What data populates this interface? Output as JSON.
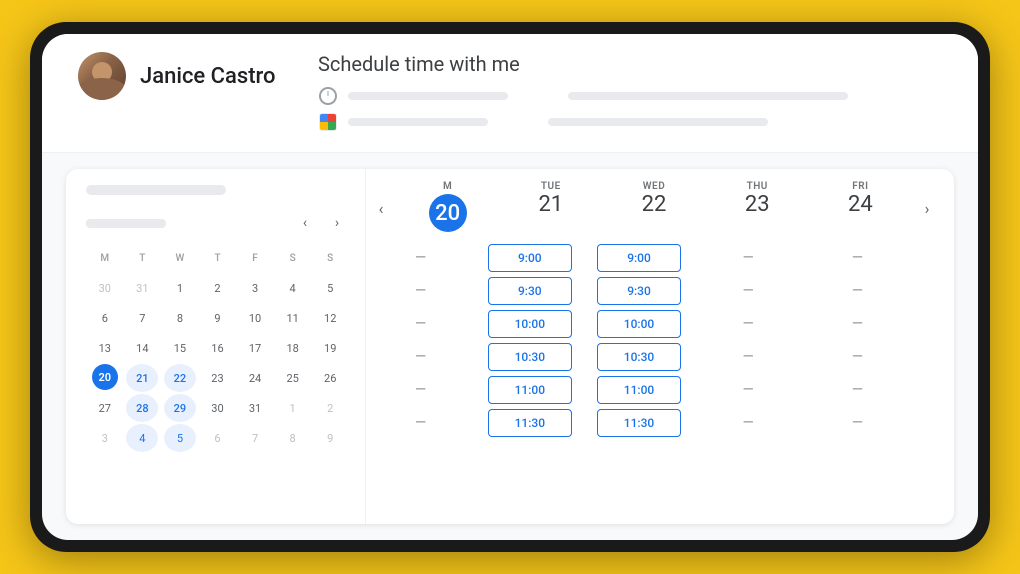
{
  "user": {
    "name": "Janice Castro"
  },
  "schedule": {
    "title": "Schedule time with me"
  },
  "calendar": {
    "top_bar": "",
    "month_label": "",
    "days_header": [
      "M",
      "T",
      "W",
      "T",
      "F",
      "S",
      "S"
    ],
    "weeks": [
      [
        {
          "n": 30,
          "other": true
        },
        {
          "n": 31,
          "other": true
        },
        {
          "n": 1
        },
        {
          "n": 2
        },
        {
          "n": 3
        },
        {
          "n": 4
        },
        {
          "n": 5
        }
      ],
      [
        {
          "n": 6
        },
        {
          "n": 7
        },
        {
          "n": 8
        },
        {
          "n": 9
        },
        {
          "n": 10
        },
        {
          "n": 11
        },
        {
          "n": 12
        }
      ],
      [
        {
          "n": 13
        },
        {
          "n": 14
        },
        {
          "n": 15
        },
        {
          "n": 16
        },
        {
          "n": 17
        },
        {
          "n": 18
        },
        {
          "n": 19
        }
      ],
      [
        {
          "n": 20,
          "today": true
        },
        {
          "n": 21,
          "selected": true
        },
        {
          "n": 22,
          "selected": true
        },
        {
          "n": 23
        },
        {
          "n": 24
        },
        {
          "n": 25
        },
        {
          "n": 26
        }
      ],
      [
        {
          "n": 27
        },
        {
          "n": 28,
          "selected": true
        },
        {
          "n": 29,
          "selected": true
        },
        {
          "n": 30
        },
        {
          "n": 31
        },
        {
          "n": 1,
          "other": true
        },
        {
          "n": 2,
          "other": true
        }
      ],
      [
        {
          "n": 3,
          "other": true
        },
        {
          "n": 4,
          "next_sel": true
        },
        {
          "n": 5,
          "next_sel": true
        },
        {
          "n": 6,
          "other": true
        },
        {
          "n": 7,
          "other": true
        },
        {
          "n": 8,
          "other": true
        },
        {
          "n": 9,
          "other": true
        }
      ]
    ]
  },
  "week_columns": [
    {
      "label": "MON",
      "day": "20",
      "today": true,
      "slots": [
        "—",
        "—",
        "—",
        "—",
        "—",
        "—"
      ]
    },
    {
      "label": "TUE",
      "day": "21",
      "today": false,
      "slots": [
        "9:00",
        "9:30",
        "10:00",
        "10:30",
        "11:00",
        "11:30"
      ]
    },
    {
      "label": "WED",
      "day": "22",
      "today": false,
      "slots": [
        "9:00",
        "9:30",
        "10:00",
        "10:30",
        "11:00",
        "11:30"
      ]
    },
    {
      "label": "THU",
      "day": "23",
      "today": false,
      "slots": [
        "—",
        "—",
        "—",
        "—",
        "—",
        "—"
      ]
    },
    {
      "label": "FRI",
      "day": "24",
      "today": false,
      "slots": [
        "—",
        "—",
        "—",
        "—",
        "—",
        "—"
      ]
    }
  ],
  "nav": {
    "prev_arrow": "‹",
    "next_arrow": "›",
    "cal_prev": "‹",
    "cal_next": "›"
  }
}
